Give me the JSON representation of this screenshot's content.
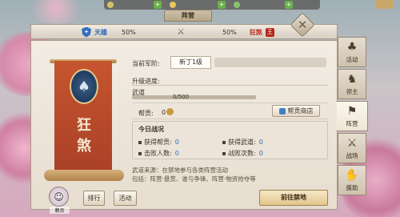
{
  "window": {
    "title": "阵营"
  },
  "factions": {
    "left": {
      "name": "天雄",
      "percent": "50%",
      "icon": "blue-shield-icon",
      "color": "#2a68b4"
    },
    "right": {
      "name": "狂煞",
      "percent": "50%",
      "icon": "red-badge-icon",
      "color": "#c0281e"
    }
  },
  "banner": {
    "text_line1": "狂",
    "text_line2": "煞"
  },
  "rank": {
    "label": "当前军阶:",
    "value": "新丁1级"
  },
  "progress": {
    "label": "升级进度:",
    "wudao_label": "武道",
    "wudao_value": "0/500",
    "wudao_fraction": 0
  },
  "contribution": {
    "label": "帮贡:",
    "value": "0",
    "shop_button": "帮贡商店"
  },
  "today": {
    "title": "今日战况",
    "stats": [
      {
        "label": "获得帮贡:",
        "value": "0"
      },
      {
        "label": "获得武道:",
        "value": "0"
      },
      {
        "label": "击败人数:",
        "value": "0"
      },
      {
        "label": "战败次数:",
        "value": "0"
      }
    ]
  },
  "notes": {
    "line1": "武道来源：在禁地参与各类阵营活动",
    "line2": "包括：阵营·悬赏、谁与争锋、阵营·物资抢夺等"
  },
  "bottom": {
    "avatar_name": "赖贡",
    "rank_button": "排行",
    "activity_button": "活动",
    "go_button": "前往禁地"
  },
  "sidenav": [
    {
      "label": "活动",
      "icon": "activity-icon",
      "glyph": "♣"
    },
    {
      "label": "领主",
      "icon": "lord-icon",
      "glyph": "♞"
    },
    {
      "label": "阵营",
      "icon": "camp-icon",
      "glyph": "⚑"
    },
    {
      "label": "战场",
      "icon": "battlefield-icon",
      "glyph": "⚔"
    },
    {
      "label": "援助",
      "icon": "aid-icon",
      "glyph": "✋"
    }
  ],
  "colors": {
    "accent_blue": "#2f6fbf",
    "accent_red": "#b3261b",
    "banner_red": "#a83f26"
  }
}
